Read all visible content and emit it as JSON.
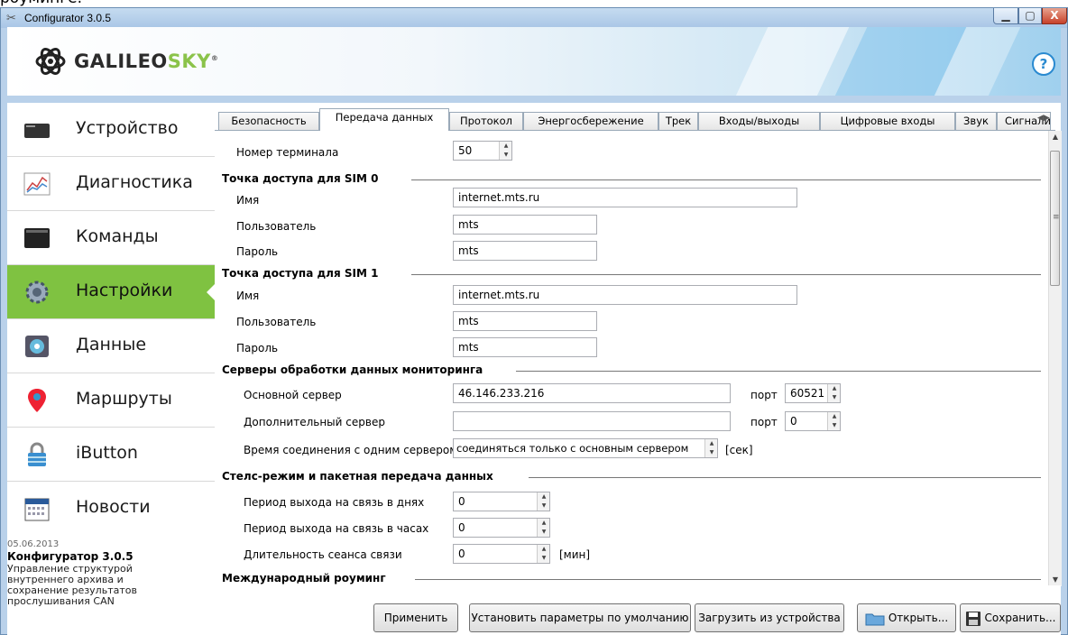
{
  "overflow_text": "роуминге.",
  "window": {
    "title": "Configurator 3.0.5",
    "min_glyph": "▁",
    "max_glyph": "▢",
    "close_glyph": "X"
  },
  "header": {
    "logo_part1": "GALILEO",
    "logo_part2": "SKY",
    "logo_reg": "®",
    "help": "?"
  },
  "sidebar": {
    "items": [
      {
        "label": "Устройство",
        "icon": "device-icon"
      },
      {
        "label": "Диагностика",
        "icon": "chart-icon"
      },
      {
        "label": "Команды",
        "icon": "terminal-icon"
      },
      {
        "label": "Настройки",
        "icon": "gear-icon",
        "active": true
      },
      {
        "label": "Данные",
        "icon": "data-icon"
      },
      {
        "label": "Маршруты",
        "icon": "map-pin-icon"
      },
      {
        "label": "iButton",
        "icon": "lock-icon"
      },
      {
        "label": "Новости",
        "icon": "calendar-icon"
      }
    ],
    "news": {
      "date": "05.06.2013",
      "title": "Конфигуратор 3.0.5",
      "text": "Управление структурой внутреннего архива и сохранение результатов прослушивания CAN"
    }
  },
  "tabs": [
    "Безопасность",
    "Передача данных",
    "Протокол",
    "Энергосбережение",
    "Трек",
    "Входы/выходы",
    "Цифровые входы",
    "Звук",
    "Сигнализация"
  ],
  "active_tab": "Передача данных",
  "form": {
    "terminal_number_label": "Номер терминала",
    "terminal_number_value": "50",
    "sim0": {
      "title": "Точка доступа для SIM 0",
      "name_label": "Имя",
      "name_value": "internet.mts.ru",
      "user_label": "Пользователь",
      "user_value": "mts",
      "pass_label": "Пароль",
      "pass_value": "mts"
    },
    "sim1": {
      "title": "Точка доступа для SIM 1",
      "name_label": "Имя",
      "name_value": "internet.mts.ru",
      "user_label": "Пользователь",
      "user_value": "mts",
      "pass_label": "Пароль",
      "pass_value": "mts"
    },
    "servers": {
      "title": "Серверы обработки данных мониторинга",
      "main_label": "Основной сервер",
      "main_value": "46.146.233.216",
      "port_label": "порт",
      "main_port": "60521",
      "alt_label": "Дополнительный сервер",
      "alt_value": "",
      "alt_port": "0",
      "conn_label": "Время соединения с одним сервером",
      "conn_value": "соединяться только с основным сервером",
      "conn_unit": "[сек]"
    },
    "stealth": {
      "title": "Стелс-режим и пакетная передача данных",
      "days_label": "Период выхода на связь в днях",
      "days_value": "0",
      "hours_label": "Период выхода на связь в часах",
      "hours_value": "0",
      "session_label": "Длительность сеанса связи",
      "session_value": "0",
      "session_unit": "[мин]"
    },
    "roaming": {
      "title": "Международный роуминг"
    }
  },
  "buttons": {
    "apply": "Применить",
    "defaults": "Установить параметры по умолчанию",
    "load": "Загрузить из устройства",
    "open": "Открыть...",
    "save": "Сохранить..."
  },
  "colors": {
    "active_nav": "#7fc241",
    "brand_green": "#8bc34a",
    "help_blue": "#2a8ad0"
  }
}
